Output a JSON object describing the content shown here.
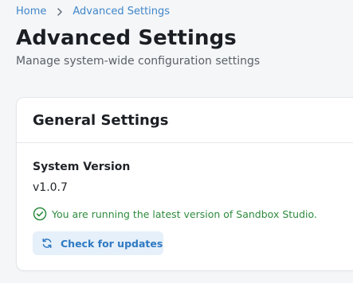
{
  "breadcrumb": {
    "items": [
      {
        "label": "Home"
      },
      {
        "label": "Advanced Settings"
      }
    ],
    "separator_icon": "chevron-right-icon"
  },
  "page": {
    "title": "Advanced Settings",
    "subtitle": "Manage system-wide configuration settings"
  },
  "general_settings": {
    "title": "General Settings",
    "system_version_label": "System Version",
    "system_version_value": "v1.0.7",
    "status_icon": "check-circle-icon",
    "status_text": "You are running the latest version of Sandbox Studio.",
    "update_button_icon": "refresh-icon",
    "update_button_label": "Check for updates"
  },
  "colors": {
    "link": "#3f86c9",
    "success": "#2e8b3e",
    "button_bg": "#e6f0fa",
    "button_text": "#2f79c2"
  }
}
